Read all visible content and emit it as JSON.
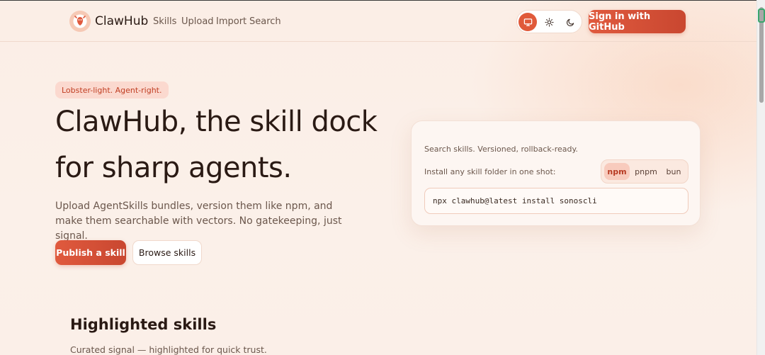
{
  "header": {
    "brand": "ClawHub",
    "nav": [
      "Skills",
      "Upload",
      "Import",
      "Search"
    ],
    "theme_options": [
      "monitor-icon",
      "sun-icon",
      "moon-icon"
    ],
    "active_theme": "system",
    "signin_label": "Sign in with GitHub"
  },
  "hero": {
    "tag": "Lobster-light. Agent-right.",
    "title_line1": "ClawHub, the skill dock",
    "title_line2": "for sharp agents.",
    "subtitle": "Upload AgentSkills bundles, version them like npm, and make them searchable with vectors. No gatekeeping, just signal.",
    "primary_button": "Publish a skill",
    "secondary_button": "Browse skills"
  },
  "install_card": {
    "line1": "Search skills. Versioned, rollback-ready.",
    "line2": "Install any skill folder in one shot:",
    "package_managers": [
      "npm",
      "pnpm",
      "bun"
    ],
    "selected_pm": "npm",
    "command": "npx clawhub@latest install sonoscli"
  },
  "highlighted": {
    "title": "Highlighted skills",
    "subtitle": "Curated signal — highlighted for quick trust."
  },
  "colors": {
    "accent": "#e05a3e",
    "background": "#fbeee6",
    "text": "#2a1a14"
  }
}
